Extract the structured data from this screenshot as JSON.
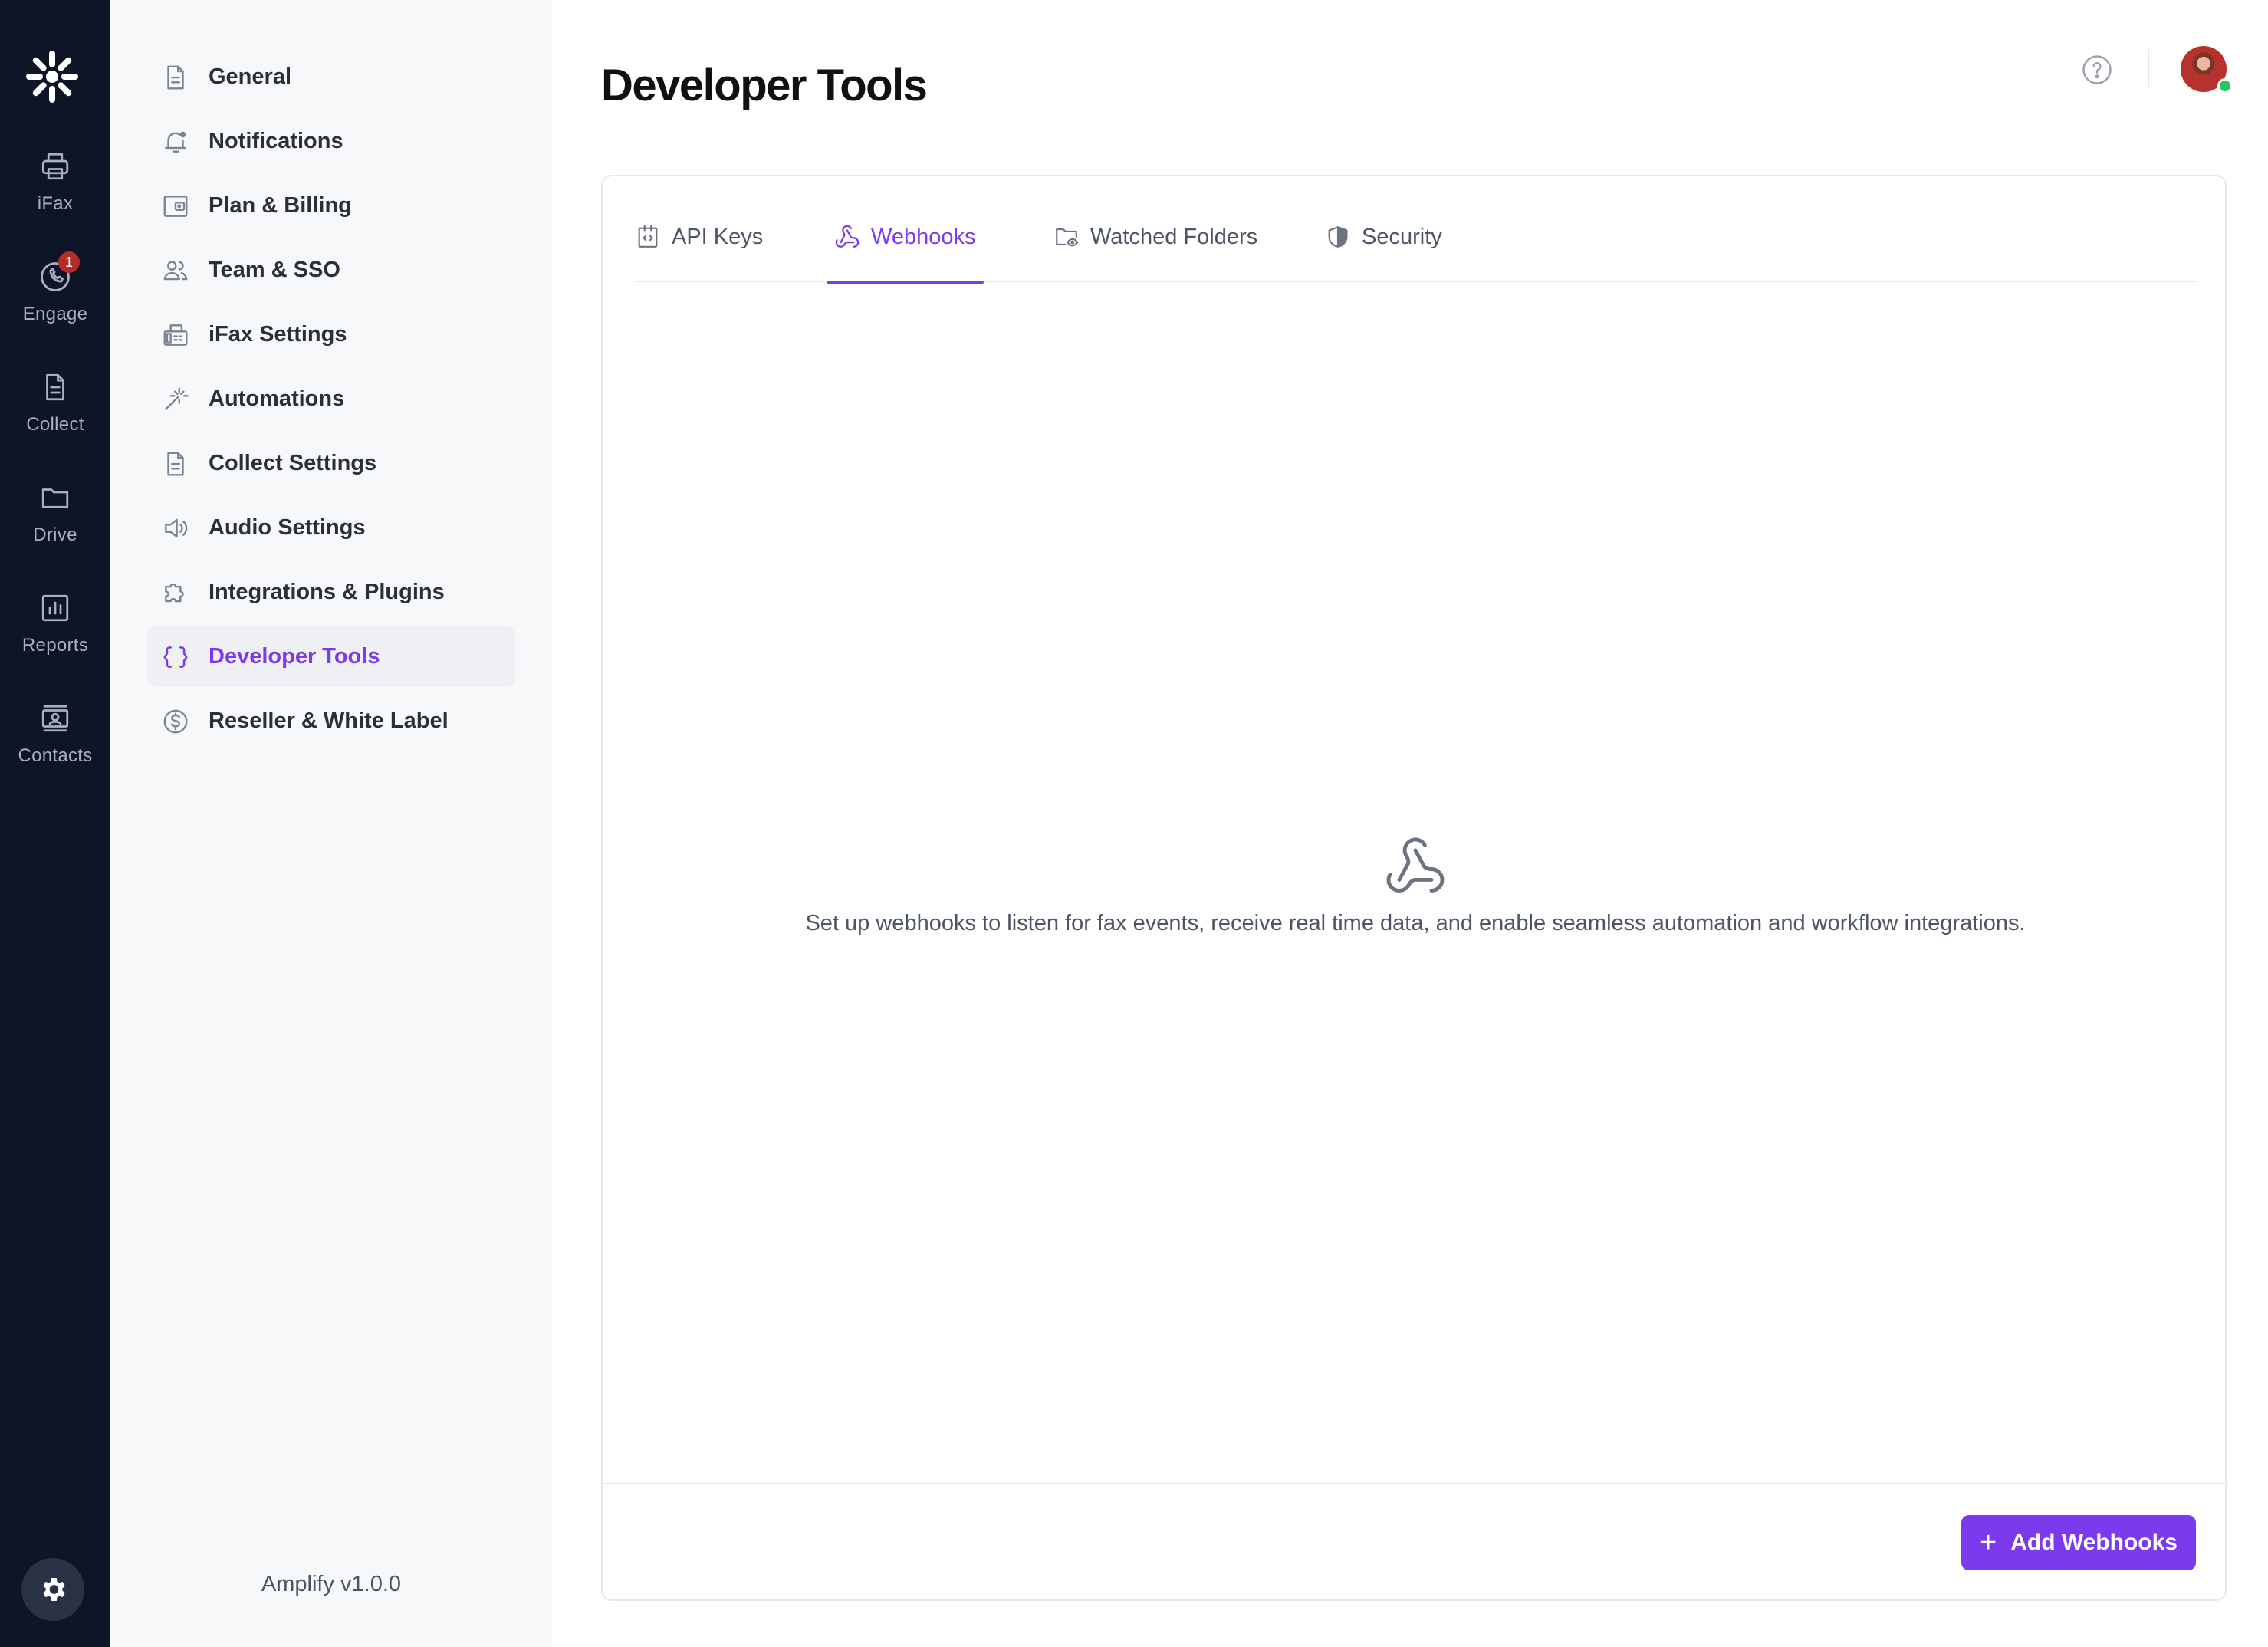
{
  "rail": {
    "items": [
      {
        "label": "iFax",
        "icon": "printer-icon"
      },
      {
        "label": "Engage",
        "icon": "phone-icon",
        "badge": "1"
      },
      {
        "label": "Collect",
        "icon": "document-icon"
      },
      {
        "label": "Drive",
        "icon": "folder-icon"
      },
      {
        "label": "Reports",
        "icon": "chart-icon"
      },
      {
        "label": "Contacts",
        "icon": "contact-card-icon"
      }
    ],
    "settings_icon": "gear-icon"
  },
  "settings_nav": {
    "items": [
      {
        "label": "General",
        "icon": "document-icon"
      },
      {
        "label": "Notifications",
        "icon": "bell-icon"
      },
      {
        "label": "Plan & Billing",
        "icon": "wallet-icon"
      },
      {
        "label": "Team & SSO",
        "icon": "users-icon"
      },
      {
        "label": "iFax Settings",
        "icon": "fax-icon"
      },
      {
        "label": "Automations",
        "icon": "magic-wand-icon"
      },
      {
        "label": "Collect Settings",
        "icon": "document-icon"
      },
      {
        "label": "Audio Settings",
        "icon": "speaker-icon"
      },
      {
        "label": "Integrations & Plugins",
        "icon": "puzzle-icon"
      },
      {
        "label": "Developer Tools",
        "icon": "braces-icon",
        "active": true
      },
      {
        "label": "Reseller & White Label",
        "icon": "dollar-coin-icon"
      }
    ],
    "version": "Amplify v1.0.0"
  },
  "header": {
    "title": "Developer Tools"
  },
  "tabs": [
    {
      "label": "API Keys",
      "icon": "code-file-icon"
    },
    {
      "label": "Webhooks",
      "icon": "webhook-icon",
      "active": true
    },
    {
      "label": "Watched Folders",
      "icon": "folder-eye-icon"
    },
    {
      "label": "Security",
      "icon": "shield-icon"
    }
  ],
  "empty_state": {
    "icon": "webhook-icon",
    "text": "Set up webhooks to listen for fax events, receive real time data, and enable seamless automation and workflow integrations."
  },
  "actions": {
    "add_label": "Add Webhooks"
  },
  "colors": {
    "accent": "#7c3aed",
    "rail_bg": "#0d1526",
    "sidebar_bg": "#f7f8fa",
    "badge": "#b42b2b",
    "online": "#22c55e"
  }
}
